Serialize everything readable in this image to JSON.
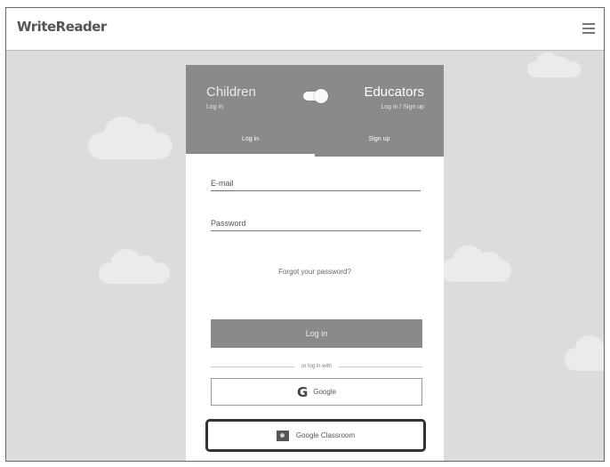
{
  "header": {
    "logo_text": "WriteReader",
    "menu_icon": "hamburger-menu-icon"
  },
  "roles": {
    "children": {
      "title": "Children",
      "sub": "Log in"
    },
    "educators": {
      "title": "Educators",
      "sub": "Log in / Sign up"
    },
    "toggle_state": "educators"
  },
  "tabs": [
    {
      "label": "Log in",
      "active": true
    },
    {
      "label": "Sign up",
      "active": false
    }
  ],
  "form": {
    "email_label": "E-mail",
    "password_label": "Password",
    "forgot_link": "Forgot your password?",
    "login_button": "Log in",
    "divider_text": "or log in with"
  },
  "social": {
    "google_label": "Google",
    "google_icon": "google-g-icon",
    "classroom_label": "Google Classroom",
    "classroom_icon": "google-classroom-icon"
  },
  "colors": {
    "header_gray": "#8a8a8a",
    "background_gray": "#dcdcdc",
    "highlight_border": "#333333"
  }
}
